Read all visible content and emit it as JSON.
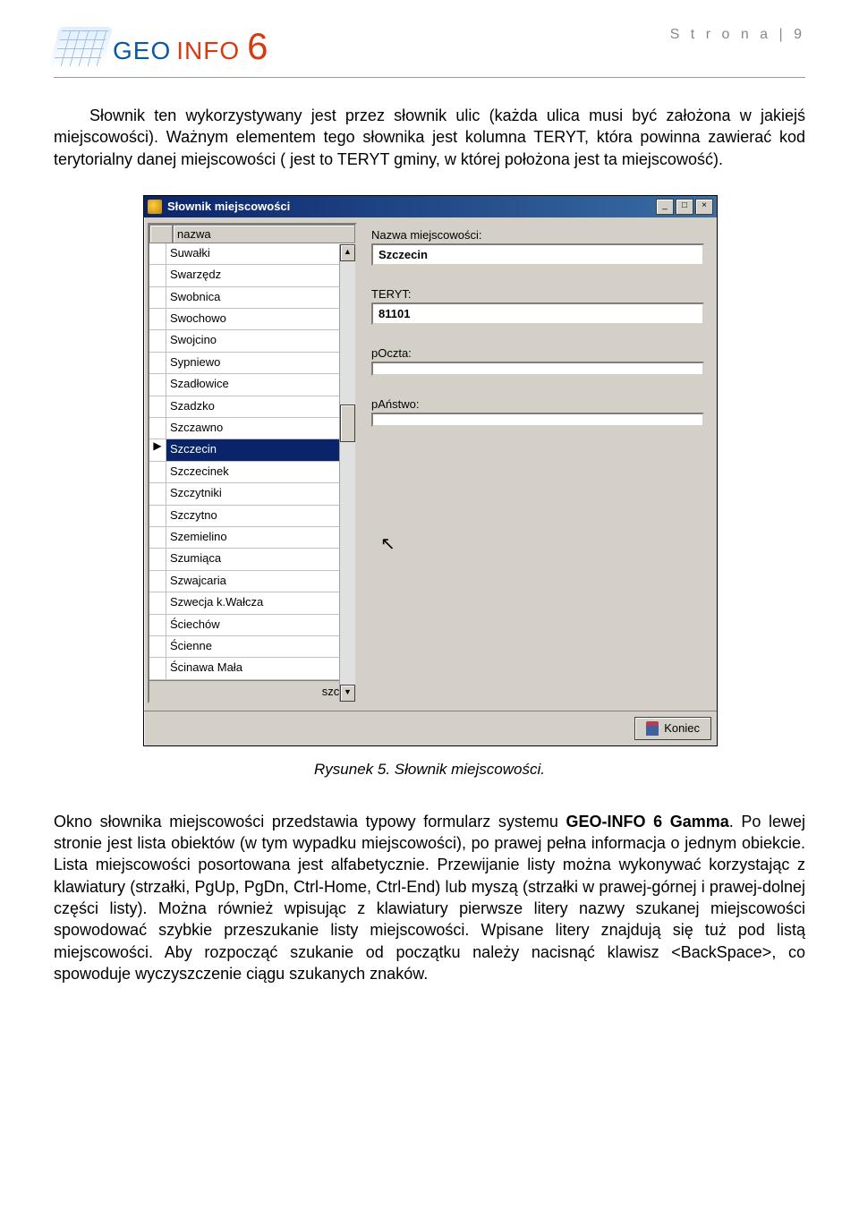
{
  "header": {
    "page_label": "S t r o n a  | 9",
    "logo_geo": "GEO",
    "logo_info": "INFO",
    "logo_six": "6"
  },
  "para1": "Słownik ten wykorzystywany jest przez słownik ulic (każda ulica musi być założona w jakiejś miejscowości). Ważnym elementem tego słownika jest kolumna TERYT, która powinna zawierać kod terytorialny danej miejscowości ( jest to TERYT gminy, w której położona jest ta miejscowość).",
  "caption": "Rysunek 5. Słownik miejscowości.",
  "para2_a": "Okno słownika miejscowości przedstawia typowy formularz systemu ",
  "para2_b_bold": "GEO-INFO 6 Gamma",
  "para2_c": ". Po lewej stronie jest lista obiektów (w tym wypadku miejscowości), po prawej pełna informacja o jednym obiekcie. Lista miejscowości posortowana jest alfabetycznie. Przewijanie listy można wykonywać korzystając z klawiatury (strzałki, PgUp, PgDn, Ctrl-Home, Ctrl-End) lub myszą (strzałki w prawej-górnej i prawej-dolnej części listy). Można również wpisując z klawiatury pierwsze litery nazwy szukanej miejscowości spowodować szybkie przeszukanie listy miejscowości. Wpisane litery znajdują się tuż pod listą miejscowości. Aby rozpocząć szukanie od początku należy nacisnąć klawisz <BackSpace>, co spowoduje wyczyszczenie ciągu szukanych znaków.",
  "window": {
    "title": "Słownik miejscowości",
    "list_header": "nazwa",
    "items": [
      "Suwałki",
      "Swarzędz",
      "Swobnica",
      "Swochowo",
      "Swojcino",
      "Sypniewo",
      "Szadłowice",
      "Szadzko",
      "Szczawno",
      "Szczecin",
      "Szczecinek",
      "Szczytniki",
      "Szczytno",
      "Szemielino",
      "Szumiąca",
      "Szwajcaria",
      "Szwecja k.Wałcza",
      "Ściechów",
      "Ścienne",
      "Ścinawa Mała"
    ],
    "selected_index": 9,
    "search_text": "szcze",
    "fields": {
      "nazwa_label": "Nazwa miejscowości:",
      "nazwa_value": "Szczecin",
      "teryt_label": "TERYT:",
      "teryt_value": "81101",
      "poczta_label": "pOczta:",
      "poczta_value": "",
      "panstwo_label": "pAństwo:",
      "panstwo_value": ""
    },
    "button_end": "Koniec",
    "minimize": "_",
    "maximize": "□",
    "close": "×",
    "scroll_up": "▲",
    "scroll_down": "▼",
    "pointer": "▶"
  }
}
